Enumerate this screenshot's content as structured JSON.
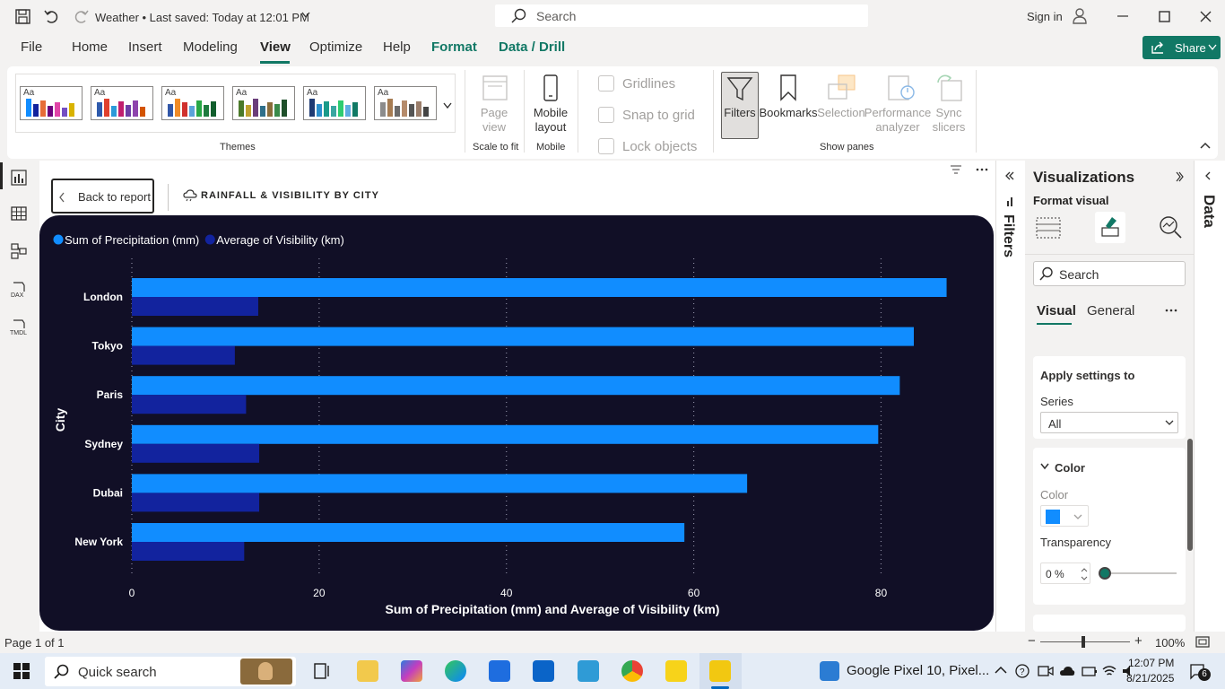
{
  "titlebar": {
    "title": "Weather • Last saved: Today at 12:01 PM",
    "search_placeholder": "Search",
    "signin": "Sign in"
  },
  "menu": {
    "tabs": [
      "File",
      "Home",
      "Insert",
      "Modeling",
      "View",
      "Optimize",
      "Help",
      "Format",
      "Data / Drill"
    ],
    "active": "View",
    "share": "Share"
  },
  "ribbon": {
    "themes_label": "Themes",
    "theme_aa": "Aa",
    "page_view": "Page view",
    "scale_label": "Scale to fit",
    "mobile_layout": "Mobile layout",
    "mobile_label": "Mobile",
    "gridlines": "Gridlines",
    "snap": "Snap to grid",
    "lock": "Lock objects",
    "filters": "Filters",
    "bookmarks": "Bookmarks",
    "selection": "Selection",
    "performance": "Performance analyzer",
    "sync": "Sync slicers",
    "show_panes": "Show panes"
  },
  "canvas": {
    "back_button": "Back to report",
    "header": "RAINFALL & VISIBILITY BY CITY"
  },
  "chart_data": {
    "type": "bar",
    "orientation": "horizontal",
    "categories": [
      "London",
      "Tokyo",
      "Paris",
      "Sydney",
      "Dubai",
      "New York"
    ],
    "series": [
      {
        "name": "Sum of Precipitation (mm)",
        "color": "#118dff",
        "values": [
          87,
          83.5,
          82,
          79.7,
          65.7,
          59
        ]
      },
      {
        "name": "Average of Visibility (km)",
        "color": "#12239e",
        "values": [
          13.5,
          11,
          12.2,
          13.6,
          13.6,
          12
        ]
      }
    ],
    "xlabel": "Sum of Precipitation (mm) and Average of Visibility (km)",
    "ylabel": "City",
    "xticks": [
      0,
      20,
      40,
      60,
      80
    ],
    "xlim": [
      0,
      88
    ],
    "grid": "vertical dotted",
    "legend": "top-left",
    "background": "#110f26"
  },
  "filters_pane": {
    "label": "Filters"
  },
  "viz_pane": {
    "title": "Visualizations",
    "subtitle": "Format visual",
    "search": "Search",
    "tabs": [
      "Visual",
      "General"
    ],
    "apply_settings": "Apply settings to",
    "series_label": "Series",
    "series_value": "All",
    "color_section": "Color",
    "color_label": "Color",
    "color_swatch": "#118dff",
    "transparency_label": "Transparency",
    "transparency_value": "0 %"
  },
  "data_pane": {
    "label": "Data"
  },
  "status": {
    "page": "Page 1 of 1",
    "zoom": "100%"
  },
  "taskbar": {
    "search": "Quick search",
    "notification": "Google Pixel 10, Pixel...",
    "time": "12:07 PM",
    "date": "8/21/2025",
    "badge": "6"
  }
}
